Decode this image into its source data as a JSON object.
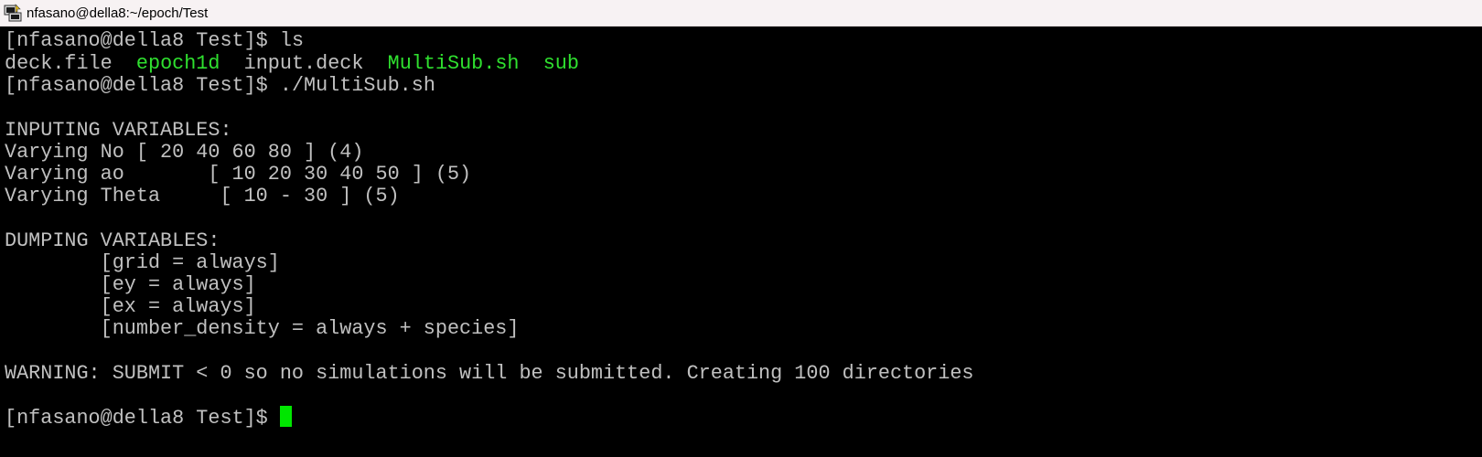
{
  "window": {
    "title": "nfasano@della8:~/epoch/Test",
    "icon": "putty-terminal-icon"
  },
  "terminal": {
    "prompt": "[nfasano@della8 Test]$ ",
    "cmd1": "ls",
    "ls_output": [
      {
        "name": "deck.file",
        "color": "#c0c0c0"
      },
      {
        "name": "epoch1d",
        "color": "#2fe02f"
      },
      {
        "name": "input.deck",
        "color": "#c0c0c0"
      },
      {
        "name": "MultiSub.sh",
        "color": "#2fe02f"
      },
      {
        "name": "sub",
        "color": "#2fe02f"
      }
    ],
    "cmd2": "./MultiSub.sh",
    "inputing_header": "INPUTING VARIABLES:",
    "varying": [
      "Varying No [ 20 40 60 80 ] (4)",
      "Varying ao       [ 10 20 30 40 50 ] (5)",
      "Varying Theta     [ 10 - 30 ] (5)"
    ],
    "dumping_header": "DUMPING VARIABLES:",
    "dumping": [
      "        [grid = always]",
      "        [ey = always]",
      "        [ex = always]",
      "        [number_density = always + species]"
    ],
    "warning": "WARNING: SUBMIT < 0 so no simulations will be submitted. Creating 100 directories",
    "text_color": "#c0c0c0",
    "exec_color": "#2fe02f",
    "cursor_color": "#00e600"
  }
}
